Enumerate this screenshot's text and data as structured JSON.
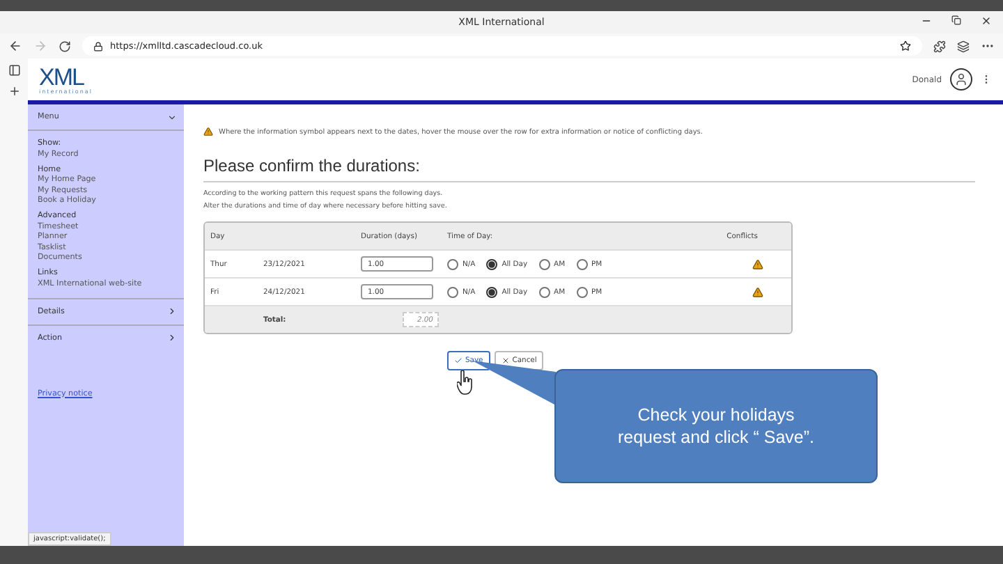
{
  "browser": {
    "tab_title": "XML International",
    "url": "https://xmlltd.cascadecloud.co.uk",
    "status_text": "javascript:validate();"
  },
  "header": {
    "logo": "XML",
    "logo_sub": "international",
    "user": "Donald"
  },
  "sidebar": {
    "menu": {
      "label": "Menu",
      "expanded": true
    },
    "groups": [
      {
        "heading": "Show:",
        "items": [
          "My Record"
        ]
      },
      {
        "heading": "Home",
        "items": [
          "My Home Page",
          "My Requests",
          "Book a Holiday"
        ]
      },
      {
        "heading": "Advanced",
        "items": [
          "Timesheet",
          "Planner",
          "Tasklist",
          "Documents"
        ]
      },
      {
        "heading": "Links",
        "items": [
          "XML International web-site"
        ]
      }
    ],
    "sections": [
      {
        "label": "Details",
        "expanded": false
      },
      {
        "label": "Action",
        "expanded": false
      }
    ],
    "privacy_link": "Privacy notice"
  },
  "notice": "Where the information symbol appears next to the dates, hover the mouse over the row for extra information or notice of conflicting days.",
  "heading": "Please confirm the durations:",
  "intro": [
    "According to the working pattern this request spans the following days.",
    "Alter the durations and time of day where necessary before hitting save."
  ],
  "table": {
    "columns": [
      "Day",
      "Duration (days)",
      "Time of Day:",
      "Conflicts"
    ],
    "rows": [
      {
        "day": "Thur",
        "date": "23/12/2021",
        "duration": "1.00",
        "options": [
          {
            "label": "N/A",
            "selected": false
          },
          {
            "label": "All Day",
            "selected": true
          },
          {
            "label": "AM",
            "selected": false
          },
          {
            "label": "PM",
            "selected": false
          }
        ],
        "conflict": true
      },
      {
        "day": "Fri",
        "date": "24/12/2021",
        "duration": "1.00",
        "options": [
          {
            "label": "N/A",
            "selected": false
          },
          {
            "label": "All Day",
            "selected": true
          },
          {
            "label": "AM",
            "selected": false
          },
          {
            "label": "PM",
            "selected": false
          }
        ],
        "conflict": true
      }
    ],
    "total_label": "Total:",
    "total": "2.00"
  },
  "buttons": [
    {
      "label": "Save",
      "kind": "save",
      "focused": true
    },
    {
      "label": "Cancel",
      "kind": "cancel",
      "focused": false
    }
  ],
  "callout": "Check your holidays request and click “ Save”."
}
